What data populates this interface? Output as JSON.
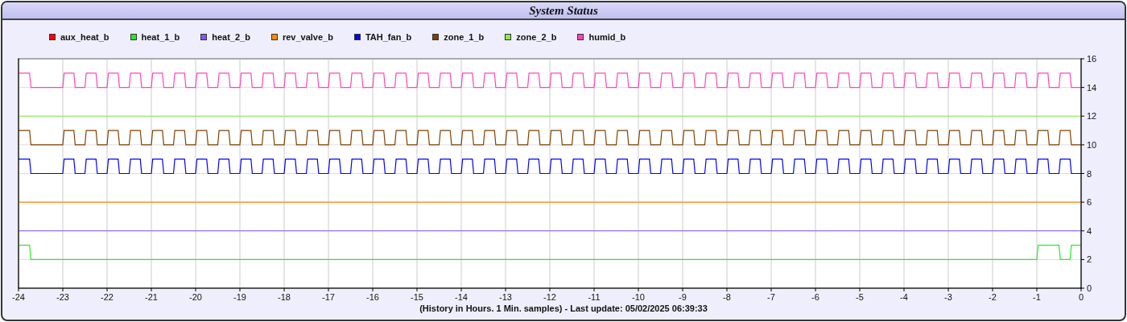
{
  "title": "System Status",
  "chart": {
    "chart_data": {
      "type": "line",
      "grid": true,
      "xlabel": "(History in Hours. 1 Min. samples) - Last update: 05/02/2025 06:39:33",
      "x": [
        -24,
        -23.97,
        -23.75,
        -23.72,
        -23.5,
        -23.47,
        -23.25,
        -23.22,
        -23,
        -22.97,
        -22.75,
        -22.72,
        -22.5,
        -22.47,
        -22.25,
        -22.22,
        -22,
        -21.97,
        -21.75,
        -21.72,
        -21.5,
        -21.47,
        -21.25,
        -21.22,
        -21,
        -20.97,
        -20.75,
        -20.72,
        -20.5,
        -20.47,
        -20.25,
        -20.22,
        -20,
        -19.97,
        -19.75,
        -19.72,
        -19.5,
        -19.47,
        -19.25,
        -19.22,
        -19,
        -18.97,
        -18.75,
        -18.72,
        -18.5,
        -18.47,
        -18.25,
        -18.22,
        -18,
        -17.97,
        -17.75,
        -17.72,
        -17.5,
        -17.47,
        -17.25,
        -17.22,
        -17,
        -16.97,
        -16.75,
        -16.72,
        -16.5,
        -16.47,
        -16.25,
        -16.22,
        -16,
        -15.97,
        -15.75,
        -15.72,
        -15.5,
        -15.47,
        -15.25,
        -15.22,
        -15,
        -14.97,
        -14.75,
        -14.72,
        -14.5,
        -14.47,
        -14.25,
        -14.22,
        -14,
        -13.97,
        -13.75,
        -13.72,
        -13.5,
        -13.47,
        -13.25,
        -13.22,
        -13,
        -12.97,
        -12.75,
        -12.72,
        -12.5,
        -12.47,
        -12.25,
        -12.22,
        -12,
        -11.97,
        -11.75,
        -11.72,
        -11.5,
        -11.47,
        -11.25,
        -11.22,
        -11,
        -10.97,
        -10.75,
        -10.72,
        -10.5,
        -10.47,
        -10.25,
        -10.22,
        -10,
        -9.97,
        -9.75,
        -9.72,
        -9.5,
        -9.47,
        -9.25,
        -9.22,
        -9,
        -8.97,
        -8.75,
        -8.72,
        -8.5,
        -8.47,
        -8.25,
        -8.22,
        -8,
        -7.97,
        -7.75,
        -7.72,
        -7.5,
        -7.47,
        -7.25,
        -7.22,
        -7,
        -6.97,
        -6.75,
        -6.72,
        -6.5,
        -6.47,
        -6.25,
        -6.22,
        -6,
        -5.97,
        -5.75,
        -5.72,
        -5.5,
        -5.47,
        -5.25,
        -5.22,
        -5,
        -4.97,
        -4.75,
        -4.72,
        -4.5,
        -4.47,
        -4.25,
        -4.22,
        -4,
        -3.97,
        -3.75,
        -3.72,
        -3.5,
        -3.47,
        -3.25,
        -3.22,
        -3,
        -2.97,
        -2.75,
        -2.72,
        -2.5,
        -2.47,
        -2.25,
        -2.22,
        -2,
        -1.97,
        -1.75,
        -1.72,
        -1.5,
        -1.47,
        -1.25,
        -1.22,
        -1,
        -0.97,
        -0.75,
        -0.72,
        -0.5,
        -0.47,
        -0.25,
        -0.22,
        0
      ],
      "xlim": [
        -24,
        0
      ],
      "ylim": [
        0,
        16
      ],
      "xticks": [
        -24,
        -23,
        -22,
        -21,
        -20,
        -19,
        -18,
        -17,
        -16,
        -15,
        -14,
        -13,
        -12,
        -11,
        -10,
        -9,
        -8,
        -7,
        -6,
        -5,
        -4,
        -3,
        -2,
        -1,
        0
      ],
      "yticks": [
        0,
        2,
        4,
        6,
        8,
        10,
        12,
        14,
        16
      ],
      "series": [
        {
          "name": "aux_heat_b",
          "color": "#ff0000",
          "values": [
            null,
            null,
            null,
            null,
            null,
            null,
            null,
            null,
            null,
            null,
            null,
            null,
            null,
            null,
            null,
            null,
            null,
            null,
            null,
            null,
            null,
            null,
            null,
            null,
            null,
            null,
            null,
            null,
            null,
            null,
            null,
            null,
            null,
            null,
            null,
            null,
            null,
            null,
            null,
            null,
            null,
            null,
            null,
            null,
            null,
            null,
            null,
            null,
            null,
            null,
            null,
            null,
            null,
            null,
            null,
            null,
            null,
            null,
            null,
            null,
            null,
            null,
            null,
            null,
            null,
            null,
            null,
            null,
            null,
            null,
            null,
            null,
            null,
            null,
            null,
            null,
            null,
            null,
            null,
            null,
            null,
            null,
            null,
            null,
            null,
            null,
            null,
            null,
            null,
            null,
            null,
            null,
            null,
            null,
            null,
            null,
            null,
            null,
            null,
            null,
            null,
            null,
            null,
            null,
            null,
            null,
            null,
            null,
            null,
            null,
            null,
            null,
            null,
            null,
            null,
            null,
            null,
            null,
            null,
            null,
            null,
            null,
            null,
            null,
            null,
            null,
            null,
            null,
            null,
            null,
            null,
            null,
            null,
            null,
            null,
            null,
            null,
            null,
            null,
            null,
            null,
            null,
            null,
            null,
            null,
            null,
            null,
            null,
            null,
            null,
            null,
            null,
            null,
            null,
            null,
            null,
            null,
            null,
            null,
            null,
            null,
            null,
            null,
            null,
            null,
            null,
            null,
            null,
            null,
            null,
            null,
            null,
            null,
            null,
            null,
            null,
            null,
            null,
            null,
            null,
            null,
            null,
            null,
            null,
            null,
            null,
            null,
            null,
            null,
            null,
            null,
            null,
            null
          ]
        },
        {
          "name": "heat_1_b",
          "color": "#22ee22",
          "values": [
            3,
            3,
            3,
            2,
            2,
            2,
            2,
            2,
            2,
            2,
            2,
            2,
            2,
            2,
            2,
            2,
            2,
            2,
            2,
            2,
            2,
            2,
            2,
            2,
            2,
            2,
            2,
            2,
            2,
            2,
            2,
            2,
            2,
            2,
            2,
            2,
            2,
            2,
            2,
            2,
            2,
            2,
            2,
            2,
            2,
            2,
            2,
            2,
            2,
            2,
            2,
            2,
            2,
            2,
            2,
            2,
            2,
            2,
            2,
            2,
            2,
            2,
            2,
            2,
            2,
            2,
            2,
            2,
            2,
            2,
            2,
            2,
            2,
            2,
            2,
            2,
            2,
            2,
            2,
            2,
            2,
            2,
            2,
            2,
            2,
            2,
            2,
            2,
            2,
            2,
            2,
            2,
            2,
            2,
            2,
            2,
            2,
            2,
            2,
            2,
            2,
            2,
            2,
            2,
            2,
            2,
            2,
            2,
            2,
            2,
            2,
            2,
            2,
            2,
            2,
            2,
            2,
            2,
            2,
            2,
            2,
            2,
            2,
            2,
            2,
            2,
            2,
            2,
            2,
            2,
            2,
            2,
            2,
            2,
            2,
            2,
            2,
            2,
            2,
            2,
            2,
            2,
            2,
            2,
            2,
            2,
            2,
            2,
            2,
            2,
            2,
            2,
            2,
            2,
            2,
            2,
            2,
            2,
            2,
            2,
            2,
            2,
            2,
            2,
            2,
            2,
            2,
            2,
            2,
            2,
            2,
            2,
            2,
            2,
            2,
            2,
            2,
            2,
            2,
            2,
            2,
            2,
            2,
            2,
            2,
            3,
            3,
            3,
            3,
            2,
            2,
            3,
            3
          ]
        },
        {
          "name": "heat_2_b",
          "color": "#8855ff",
          "values": [
            4,
            4,
            4,
            4,
            4,
            4,
            4,
            4,
            4,
            4,
            4,
            4,
            4,
            4,
            4,
            4,
            4,
            4,
            4,
            4,
            4,
            4,
            4,
            4,
            4,
            4,
            4,
            4,
            4,
            4,
            4,
            4,
            4,
            4,
            4,
            4,
            4,
            4,
            4,
            4,
            4,
            4,
            4,
            4,
            4,
            4,
            4,
            4,
            4,
            4,
            4,
            4,
            4,
            4,
            4,
            4,
            4,
            4,
            4,
            4,
            4,
            4,
            4,
            4,
            4,
            4,
            4,
            4,
            4,
            4,
            4,
            4,
            4,
            4,
            4,
            4,
            4,
            4,
            4,
            4,
            4,
            4,
            4,
            4,
            4,
            4,
            4,
            4,
            4,
            4,
            4,
            4,
            4,
            4,
            4,
            4,
            4,
            4,
            4,
            4,
            4,
            4,
            4,
            4,
            4,
            4,
            4,
            4,
            4,
            4,
            4,
            4,
            4,
            4,
            4,
            4,
            4,
            4,
            4,
            4,
            4,
            4,
            4,
            4,
            4,
            4,
            4,
            4,
            4,
            4,
            4,
            4,
            4,
            4,
            4,
            4,
            4,
            4,
            4,
            4,
            4,
            4,
            4,
            4,
            4,
            4,
            4,
            4,
            4,
            4,
            4,
            4,
            4,
            4,
            4,
            4,
            4,
            4,
            4,
            4,
            4,
            4,
            4,
            4,
            4,
            4,
            4,
            4,
            4,
            4,
            4,
            4,
            4,
            4,
            4,
            4,
            4,
            4,
            4,
            4,
            4,
            4,
            4,
            4,
            4,
            4,
            4,
            4,
            4,
            4,
            4,
            4,
            4
          ]
        },
        {
          "name": "rev_valve_b",
          "color": "#ff8800",
          "values": [
            6,
            6,
            6,
            6,
            6,
            6,
            6,
            6,
            6,
            6,
            6,
            6,
            6,
            6,
            6,
            6,
            6,
            6,
            6,
            6,
            6,
            6,
            6,
            6,
            6,
            6,
            6,
            6,
            6,
            6,
            6,
            6,
            6,
            6,
            6,
            6,
            6,
            6,
            6,
            6,
            6,
            6,
            6,
            6,
            6,
            6,
            6,
            6,
            6,
            6,
            6,
            6,
            6,
            6,
            6,
            6,
            6,
            6,
            6,
            6,
            6,
            6,
            6,
            6,
            6,
            6,
            6,
            6,
            6,
            6,
            6,
            6,
            6,
            6,
            6,
            6,
            6,
            6,
            6,
            6,
            6,
            6,
            6,
            6,
            6,
            6,
            6,
            6,
            6,
            6,
            6,
            6,
            6,
            6,
            6,
            6,
            6,
            6,
            6,
            6,
            6,
            6,
            6,
            6,
            6,
            6,
            6,
            6,
            6,
            6,
            6,
            6,
            6,
            6,
            6,
            6,
            6,
            6,
            6,
            6,
            6,
            6,
            6,
            6,
            6,
            6,
            6,
            6,
            6,
            6,
            6,
            6,
            6,
            6,
            6,
            6,
            6,
            6,
            6,
            6,
            6,
            6,
            6,
            6,
            6,
            6,
            6,
            6,
            6,
            6,
            6,
            6,
            6,
            6,
            6,
            6,
            6,
            6,
            6,
            6,
            6,
            6,
            6,
            6,
            6,
            6,
            6,
            6,
            6,
            6,
            6,
            6,
            6,
            6,
            6,
            6,
            6,
            6,
            6,
            6,
            6,
            6,
            6,
            6,
            6,
            6,
            6,
            6,
            6,
            6,
            6,
            6,
            6
          ]
        },
        {
          "name": "TAH_fan_b",
          "color": "#0000ff",
          "values": [
            9,
            9,
            9,
            8,
            8,
            8,
            8,
            8,
            8,
            9,
            9,
            8,
            8,
            9,
            9,
            8,
            8,
            9,
            9,
            8,
            8,
            9,
            9,
            8,
            8,
            9,
            9,
            8,
            8,
            9,
            9,
            8,
            8,
            9,
            9,
            8,
            8,
            9,
            9,
            8,
            8,
            9,
            9,
            8,
            8,
            9,
            9,
            8,
            8,
            9,
            9,
            8,
            8,
            9,
            9,
            8,
            8,
            9,
            9,
            8,
            8,
            9,
            9,
            8,
            8,
            9,
            9,
            8,
            8,
            9,
            9,
            8,
            8,
            9,
            9,
            8,
            8,
            9,
            9,
            8,
            8,
            9,
            9,
            8,
            8,
            9,
            9,
            8,
            8,
            9,
            9,
            8,
            8,
            9,
            9,
            8,
            8,
            9,
            9,
            8,
            8,
            9,
            9,
            8,
            8,
            9,
            9,
            8,
            8,
            9,
            9,
            8,
            8,
            9,
            9,
            8,
            8,
            9,
            9,
            8,
            8,
            9,
            9,
            8,
            8,
            9,
            9,
            8,
            8,
            9,
            9,
            8,
            8,
            9,
            9,
            8,
            8,
            9,
            9,
            8,
            8,
            9,
            9,
            8,
            8,
            9,
            9,
            8,
            8,
            9,
            9,
            8,
            8,
            9,
            9,
            8,
            8,
            9,
            9,
            8,
            8,
            9,
            9,
            8,
            8,
            9,
            9,
            8,
            8,
            9,
            9,
            8,
            8,
            9,
            9,
            8,
            8,
            9,
            9,
            8,
            8,
            9,
            9,
            8,
            8,
            9,
            9,
            8,
            8,
            9,
            9,
            8,
            8
          ]
        },
        {
          "name": "zone_1_b",
          "color": "#804000",
          "values": [
            11,
            11,
            11,
            10,
            10,
            10,
            10,
            10,
            10,
            11,
            11,
            10,
            10,
            11,
            11,
            10,
            10,
            11,
            11,
            10,
            10,
            11,
            11,
            10,
            10,
            11,
            11,
            10,
            10,
            11,
            11,
            10,
            10,
            11,
            11,
            10,
            10,
            11,
            11,
            10,
            10,
            11,
            11,
            10,
            10,
            11,
            11,
            10,
            10,
            11,
            11,
            10,
            10,
            11,
            11,
            10,
            10,
            11,
            11,
            10,
            10,
            11,
            11,
            10,
            10,
            11,
            11,
            10,
            10,
            11,
            11,
            10,
            10,
            11,
            11,
            10,
            10,
            11,
            11,
            10,
            10,
            11,
            11,
            10,
            10,
            11,
            11,
            10,
            10,
            11,
            11,
            10,
            10,
            11,
            11,
            10,
            10,
            11,
            11,
            10,
            10,
            11,
            11,
            10,
            10,
            11,
            11,
            10,
            10,
            11,
            11,
            10,
            10,
            11,
            11,
            10,
            10,
            11,
            11,
            10,
            10,
            11,
            11,
            10,
            10,
            11,
            11,
            10,
            10,
            11,
            11,
            10,
            10,
            11,
            11,
            10,
            10,
            11,
            11,
            10,
            10,
            11,
            11,
            10,
            10,
            11,
            11,
            10,
            10,
            11,
            11,
            10,
            10,
            11,
            11,
            10,
            10,
            11,
            11,
            10,
            10,
            11,
            11,
            10,
            10,
            11,
            11,
            10,
            10,
            11,
            11,
            10,
            10,
            11,
            11,
            10,
            10,
            11,
            11,
            10,
            10,
            11,
            11,
            10,
            10,
            11,
            11,
            10,
            10,
            11,
            11,
            10,
            10
          ]
        },
        {
          "name": "zone_2_b",
          "color": "#88ee44",
          "values": [
            12,
            12,
            12,
            12,
            12,
            12,
            12,
            12,
            12,
            12,
            12,
            12,
            12,
            12,
            12,
            12,
            12,
            12,
            12,
            12,
            12,
            12,
            12,
            12,
            12,
            12,
            12,
            12,
            12,
            12,
            12,
            12,
            12,
            12,
            12,
            12,
            12,
            12,
            12,
            12,
            12,
            12,
            12,
            12,
            12,
            12,
            12,
            12,
            12,
            12,
            12,
            12,
            12,
            12,
            12,
            12,
            12,
            12,
            12,
            12,
            12,
            12,
            12,
            12,
            12,
            12,
            12,
            12,
            12,
            12,
            12,
            12,
            12,
            12,
            12,
            12,
            12,
            12,
            12,
            12,
            12,
            12,
            12,
            12,
            12,
            12,
            12,
            12,
            12,
            12,
            12,
            12,
            12,
            12,
            12,
            12,
            12,
            12,
            12,
            12,
            12,
            12,
            12,
            12,
            12,
            12,
            12,
            12,
            12,
            12,
            12,
            12,
            12,
            12,
            12,
            12,
            12,
            12,
            12,
            12,
            12,
            12,
            12,
            12,
            12,
            12,
            12,
            12,
            12,
            12,
            12,
            12,
            12,
            12,
            12,
            12,
            12,
            12,
            12,
            12,
            12,
            12,
            12,
            12,
            12,
            12,
            12,
            12,
            12,
            12,
            12,
            12,
            12,
            12,
            12,
            12,
            12,
            12,
            12,
            12,
            12,
            12,
            12,
            12,
            12,
            12,
            12,
            12,
            12,
            12,
            12,
            12,
            12,
            12,
            12,
            12,
            12,
            12,
            12,
            12,
            12,
            12,
            12,
            12,
            12,
            12,
            12,
            12,
            12,
            12,
            12,
            12,
            12
          ]
        },
        {
          "name": "humid_b",
          "color": "#ff44bb",
          "values": [
            15,
            15,
            15,
            14,
            14,
            14,
            14,
            14,
            14,
            15,
            15,
            14,
            14,
            15,
            15,
            14,
            14,
            15,
            15,
            14,
            14,
            15,
            15,
            14,
            14,
            15,
            15,
            14,
            14,
            15,
            15,
            14,
            14,
            15,
            15,
            14,
            14,
            15,
            15,
            14,
            14,
            15,
            15,
            14,
            14,
            15,
            15,
            14,
            14,
            15,
            15,
            14,
            14,
            15,
            15,
            14,
            14,
            15,
            15,
            14,
            14,
            15,
            15,
            14,
            14,
            15,
            15,
            14,
            14,
            15,
            15,
            14,
            14,
            15,
            15,
            14,
            14,
            15,
            15,
            14,
            14,
            15,
            15,
            14,
            14,
            15,
            15,
            14,
            14,
            15,
            15,
            14,
            14,
            15,
            15,
            14,
            14,
            15,
            15,
            14,
            14,
            15,
            15,
            14,
            14,
            15,
            15,
            14,
            14,
            15,
            15,
            14,
            14,
            15,
            15,
            14,
            14,
            15,
            15,
            14,
            14,
            15,
            15,
            14,
            14,
            15,
            15,
            14,
            14,
            15,
            15,
            14,
            14,
            15,
            15,
            14,
            14,
            15,
            15,
            14,
            14,
            15,
            15,
            14,
            14,
            15,
            15,
            14,
            14,
            15,
            15,
            14,
            14,
            15,
            15,
            14,
            14,
            15,
            15,
            14,
            14,
            15,
            15,
            14,
            14,
            15,
            15,
            14,
            14,
            15,
            15,
            14,
            14,
            15,
            15,
            14,
            14,
            15,
            15,
            14,
            14,
            15,
            15,
            14,
            14,
            15,
            15,
            14,
            14,
            15,
            15,
            14,
            14
          ]
        }
      ]
    }
  }
}
